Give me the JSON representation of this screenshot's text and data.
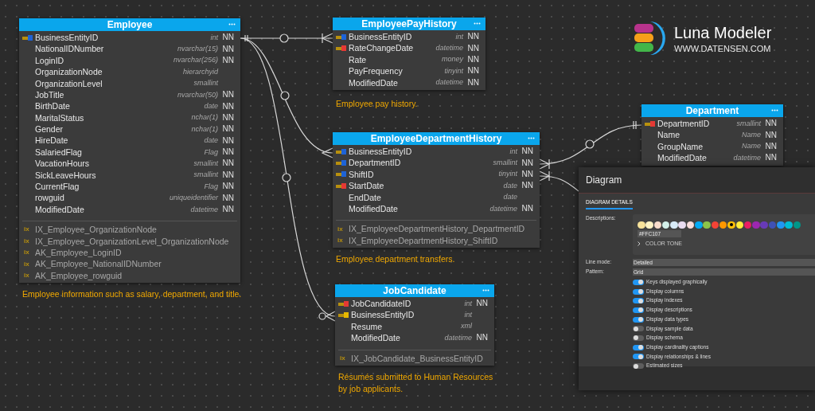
{
  "logo": {
    "title": "Luna Modeler",
    "url": "WWW.DATENSEN.COM"
  },
  "tables": [
    {
      "name": "Employee",
      "columns": [
        {
          "name": "BusinessEntityID",
          "type": "int",
          "null_flag": "NN",
          "kind": "foreign"
        },
        {
          "name": "NationalIDNumber",
          "type": "nvarchar(15)",
          "null_flag": "NN"
        },
        {
          "name": "LoginID",
          "type": "nvarchar(256)",
          "null_flag": "NN"
        },
        {
          "name": "OrganizationNode",
          "type": "hierarchyid"
        },
        {
          "name": "OrganizationLevel",
          "type": "smallint"
        },
        {
          "name": "JobTitle",
          "type": "nvarchar(50)",
          "null_flag": "NN"
        },
        {
          "name": "BirthDate",
          "type": "date",
          "null_flag": "NN"
        },
        {
          "name": "MaritalStatus",
          "type": "nchar(1)",
          "null_flag": "NN"
        },
        {
          "name": "Gender",
          "type": "nchar(1)",
          "null_flag": "NN"
        },
        {
          "name": "HireDate",
          "type": "date",
          "null_flag": "NN"
        },
        {
          "name": "SalariedFlag",
          "type": "Flag",
          "null_flag": "NN"
        },
        {
          "name": "VacationHours",
          "type": "smallint",
          "null_flag": "NN"
        },
        {
          "name": "SickLeaveHours",
          "type": "smallint",
          "null_flag": "NN"
        },
        {
          "name": "CurrentFlag",
          "type": "Flag",
          "null_flag": "NN"
        },
        {
          "name": "rowguid",
          "type": "uniqueidentifier",
          "null_flag": "NN"
        },
        {
          "name": "ModifiedDate",
          "type": "datetime",
          "null_flag": "NN"
        }
      ],
      "indexes": [
        {
          "icon": "ix",
          "name": "IX_Employee_OrganizationNode"
        },
        {
          "icon": "ix",
          "name": "IX_Employee_OrganizationLevel_OrganizationNode"
        },
        {
          "icon": "ix",
          "name": "AK_Employee_LoginID"
        },
        {
          "icon": "ix",
          "name": "AK_Employee_NationalIDNumber"
        },
        {
          "icon": "ix",
          "name": "AK_Employee_rowguid"
        }
      ],
      "description": "Employee information such as salary, department, and title."
    },
    {
      "name": "EmployeePayHistory",
      "columns": [
        {
          "name": "BusinessEntityID",
          "type": "int",
          "null_flag": "NN",
          "kind": "foreign"
        },
        {
          "name": "RateChangeDate",
          "type": "datetime",
          "null_flag": "NN",
          "kind": "primary"
        },
        {
          "name": "Rate",
          "type": "money",
          "null_flag": "NN"
        },
        {
          "name": "PayFrequency",
          "type": "tinyint",
          "null_flag": "NN"
        },
        {
          "name": "ModifiedDate",
          "type": "datetime",
          "null_flag": "NN"
        }
      ],
      "description": "Employee pay history."
    },
    {
      "name": "EmployeeDepartmentHistory",
      "columns": [
        {
          "name": "BusinessEntityID",
          "type": "int",
          "null_flag": "NN",
          "kind": "foreign"
        },
        {
          "name": "DepartmentID",
          "type": "smallint",
          "null_flag": "NN",
          "kind": "foreign"
        },
        {
          "name": "ShiftID",
          "type": "tinyint",
          "null_flag": "NN",
          "kind": "foreign"
        },
        {
          "name": "StartDate",
          "type": "date",
          "null_flag": "NN",
          "kind": "primary"
        },
        {
          "name": "EndDate",
          "type": "date"
        },
        {
          "name": "ModifiedDate",
          "type": "datetime",
          "null_flag": "NN"
        }
      ],
      "indexes": [
        {
          "icon": "ix",
          "name": "IX_EmployeeDepartmentHistory_DepartmentID"
        },
        {
          "icon": "ix",
          "name": "IX_EmployeeDepartmentHistory_ShiftID"
        }
      ],
      "description": "Employee department transfers."
    },
    {
      "name": "JobCandidate",
      "columns": [
        {
          "name": "JobCandidateID",
          "type": "int",
          "null_flag": "NN",
          "kind": "primary"
        },
        {
          "name": "BusinessEntityID",
          "type": "int",
          "kind": "unique"
        },
        {
          "name": "Resume",
          "type": "xml"
        },
        {
          "name": "ModifiedDate",
          "type": "datetime",
          "null_flag": "NN"
        }
      ],
      "indexes": [
        {
          "icon": "ix",
          "name": "IX_JobCandidate_BusinessEntityID"
        }
      ],
      "description": "Résumés submitted to Human Resources by job applicants."
    },
    {
      "name": "Department",
      "columns": [
        {
          "name": "DepartmentID",
          "type": "smallint",
          "null_flag": "NN",
          "kind": "primary"
        },
        {
          "name": "Name",
          "type": "Name",
          "null_flag": "NN"
        },
        {
          "name": "GroupName",
          "type": "Name",
          "null_flag": "NN"
        },
        {
          "name": "ModifiedDate",
          "type": "datetime",
          "null_flag": "NN"
        }
      ]
    }
  ],
  "panel": {
    "title": "Diagram",
    "tabs": [
      {
        "label": "DIAGRAM DETAILS",
        "selected": true
      }
    ],
    "descriptions_label": "Descriptions:",
    "swatches": [
      {
        "color": "#f7e29a",
        "selected": false
      },
      {
        "color": "#fdf3c4",
        "selected": false
      },
      {
        "color": "#f8dccb",
        "selected": false
      },
      {
        "color": "#d4f1ea",
        "selected": false
      },
      {
        "color": "#d7eaf7",
        "selected": false
      },
      {
        "color": "#e9dcf0",
        "selected": false
      },
      {
        "color": "#f9dcda",
        "selected": false
      },
      {
        "color": "#03a9f4",
        "selected": false
      },
      {
        "color": "#8bc34a",
        "selected": false
      },
      {
        "color": "#f44336",
        "selected": false
      },
      {
        "color": "#ff9800",
        "selected": false
      },
      {
        "color": "#ffc107",
        "selected": true
      },
      {
        "color": "#ffeb3b",
        "selected": false
      },
      {
        "color": "#e91e63",
        "selected": false
      },
      {
        "color": "#9c27b0",
        "selected": false
      },
      {
        "color": "#673ab7",
        "selected": false
      },
      {
        "color": "#3f51b5",
        "selected": false
      },
      {
        "color": "#2196f3",
        "selected": false
      },
      {
        "color": "#00bcd4",
        "selected": false
      },
      {
        "color": "#009688",
        "selected": false
      }
    ],
    "hex_value": "#FFC107",
    "color_tone": {
      "label": "COLOR TONE",
      "expanded": false
    },
    "fields": [
      {
        "label": "Line mode:",
        "value": "Detailed"
      },
      {
        "label": "Pattern:",
        "value": "Grid"
      }
    ],
    "toggles": [
      {
        "label": "Keys displayed graphically",
        "on": true
      },
      {
        "label": "Display columns",
        "on": true
      },
      {
        "label": "Display indexes",
        "on": true
      },
      {
        "label": "Display descriptions",
        "on": true
      },
      {
        "label": "Display data types",
        "on": true
      },
      {
        "label": "Display sample data",
        "on": false
      },
      {
        "label": "Display schema",
        "on": false
      },
      {
        "label": "Display cardinality captions",
        "on": true
      },
      {
        "label": "Display relationships & lines",
        "on": true
      },
      {
        "label": "Estimated sizes",
        "on": false
      }
    ]
  }
}
